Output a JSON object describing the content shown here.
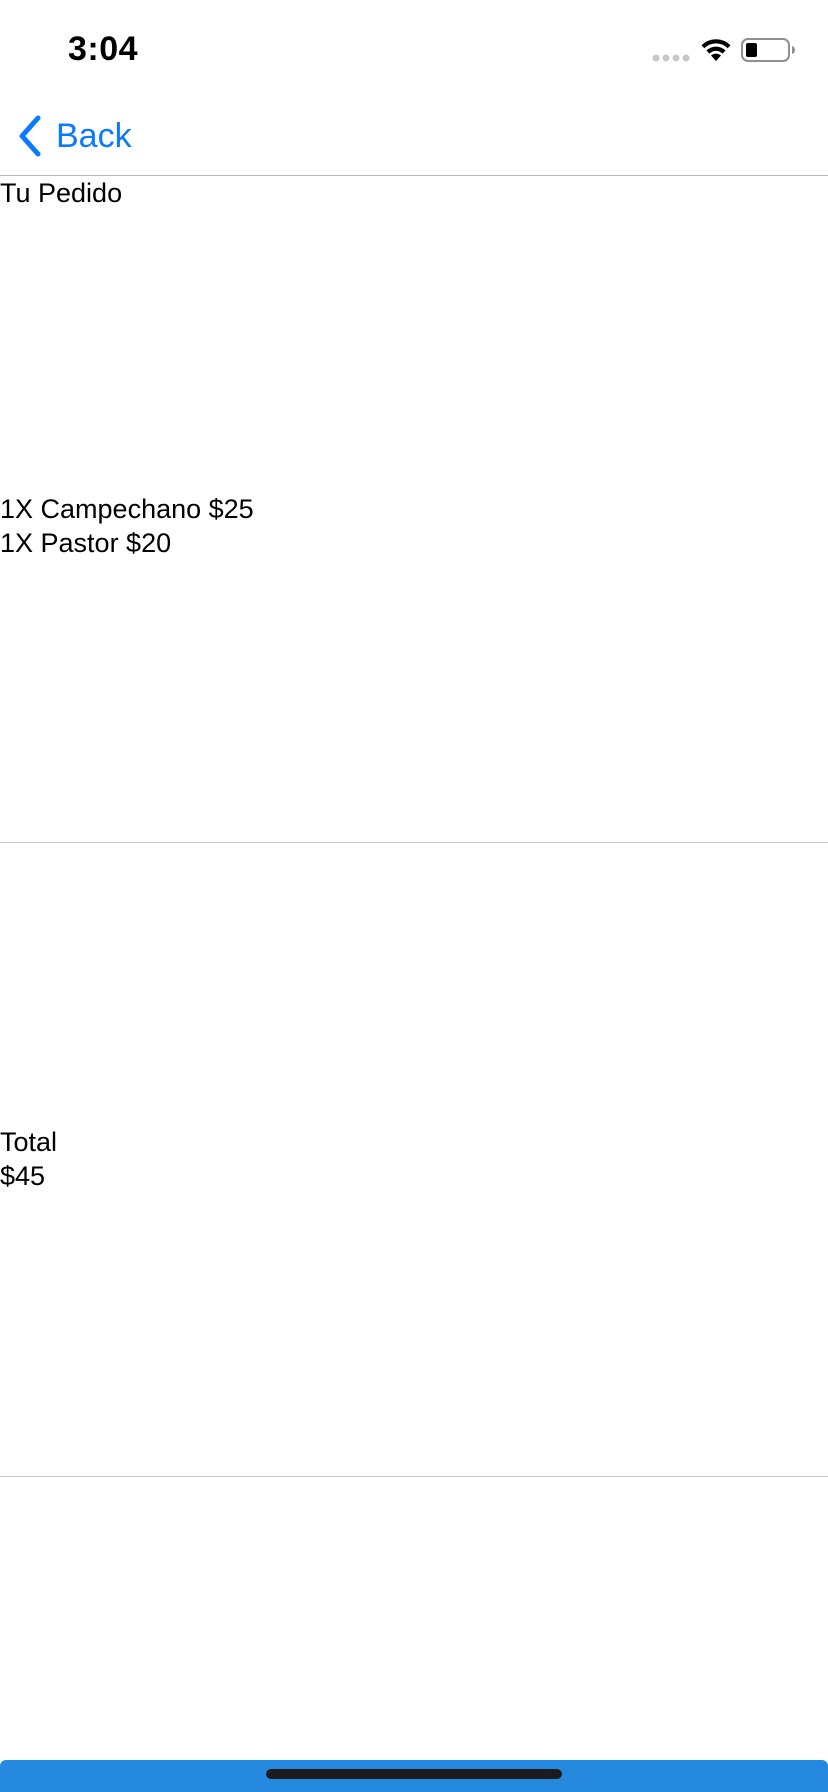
{
  "status_bar": {
    "time": "3:04"
  },
  "nav": {
    "back_label": "Back"
  },
  "order": {
    "title": "Tu Pedido",
    "items": [
      "1X Campechano $25",
      "1X Pastor $20"
    ]
  },
  "summary": {
    "total_label": "Total",
    "total_value": "$45"
  },
  "icons": {
    "status": [
      "signal-icon",
      "wifi-icon",
      "battery-icon"
    ],
    "nav": "chevron-left-icon"
  },
  "colors": {
    "accent": "#0a7aff",
    "bottom_bar": "#2589e0",
    "divider": "#c8c8cc"
  }
}
